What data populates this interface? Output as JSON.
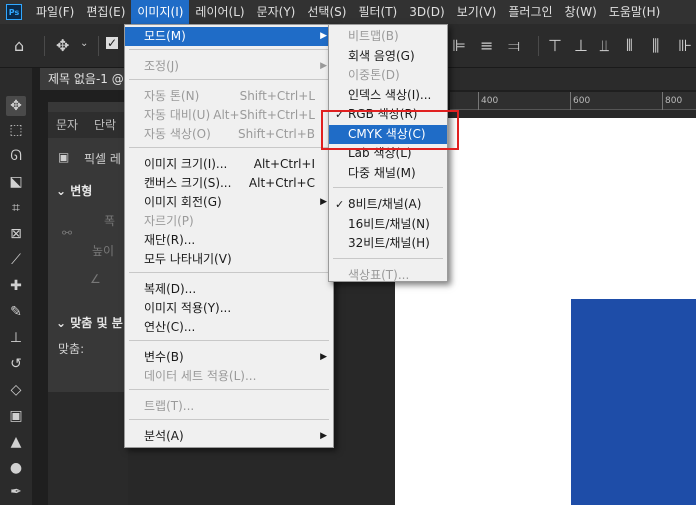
{
  "app": {
    "logo": "Ps"
  },
  "menubar": [
    "파일(F)",
    "편집(E)",
    "이미지(I)",
    "레이어(L)",
    "문자(Y)",
    "선택(S)",
    "필터(T)",
    "3D(D)",
    "보기(V)",
    "플러그인",
    "창(W)",
    "도움말(H)"
  ],
  "menubar_active_index": 2,
  "document_tab": {
    "title": "제목 없음-1 @"
  },
  "panel": {
    "tabs": [
      "문자",
      "단락"
    ],
    "pixel_label": "픽셀 레",
    "section_transform": "변형",
    "width_label": "폭",
    "height_label": "높이",
    "section_align": "맞춤 및 분",
    "align_label": "맞춤:"
  },
  "ruler": {
    "ticks": [
      "400",
      "600",
      "800"
    ]
  },
  "image_menu": {
    "items": [
      {
        "label": "모드(M)",
        "shortcut": "",
        "submenu": true,
        "disabled": false,
        "highlight": true
      },
      {
        "separator": true
      },
      {
        "label": "조정(J)",
        "shortcut": "",
        "submenu": true,
        "disabled": true
      },
      {
        "separator": true
      },
      {
        "label": "자동 톤(N)",
        "shortcut": "Shift+Ctrl+L",
        "disabled": true
      },
      {
        "label": "자동 대비(U)",
        "shortcut": "Alt+Shift+Ctrl+L",
        "disabled": true
      },
      {
        "label": "자동 색상(O)",
        "shortcut": "Shift+Ctrl+B",
        "disabled": true
      },
      {
        "separator": true
      },
      {
        "label": "이미지 크기(I)...",
        "shortcut": "Alt+Ctrl+I",
        "disabled": false
      },
      {
        "label": "캔버스 크기(S)...",
        "shortcut": "Alt+Ctrl+C",
        "disabled": false
      },
      {
        "label": "이미지 회전(G)",
        "shortcut": "",
        "submenu": true,
        "disabled": false
      },
      {
        "label": "자르기(P)",
        "shortcut": "",
        "disabled": true
      },
      {
        "label": "재단(R)...",
        "shortcut": "",
        "disabled": false
      },
      {
        "label": "모두 나타내기(V)",
        "shortcut": "",
        "disabled": false
      },
      {
        "separator": true
      },
      {
        "label": "복제(D)...",
        "shortcut": "",
        "disabled": false
      },
      {
        "label": "이미지 적용(Y)...",
        "shortcut": "",
        "disabled": false
      },
      {
        "label": "연산(C)...",
        "shortcut": "",
        "disabled": false
      },
      {
        "separator": true
      },
      {
        "label": "변수(B)",
        "shortcut": "",
        "submenu": true,
        "disabled": false
      },
      {
        "label": "데이터 세트 적용(L)...",
        "shortcut": "",
        "disabled": true
      },
      {
        "separator": true
      },
      {
        "label": "트랩(T)...",
        "shortcut": "",
        "disabled": true
      },
      {
        "separator": true
      },
      {
        "label": "분석(A)",
        "shortcut": "",
        "submenu": true,
        "disabled": false
      }
    ]
  },
  "mode_submenu": {
    "items": [
      {
        "label": "비트맵(B)",
        "disabled": true
      },
      {
        "label": "회색 음영(G)",
        "disabled": false
      },
      {
        "label": "이중톤(D)",
        "disabled": true
      },
      {
        "label": "인덱스 색상(I)...",
        "disabled": false
      },
      {
        "label": "RGB 색상(R)",
        "disabled": false,
        "checked": true
      },
      {
        "label": "CMYK 색상(C)",
        "disabled": false,
        "highlight": true
      },
      {
        "label": "Lab 색상(L)",
        "disabled": false
      },
      {
        "label": "다중 채널(M)",
        "disabled": false
      },
      {
        "separator": true
      },
      {
        "label": "8비트/채널(A)",
        "disabled": false,
        "checked": true
      },
      {
        "label": "16비트/채널(N)",
        "disabled": false
      },
      {
        "label": "32비트/채널(H)",
        "disabled": false
      },
      {
        "separator": true
      },
      {
        "label": "색상표(T)...",
        "disabled": true
      }
    ]
  },
  "colors": {
    "accent": "#1f6cc7",
    "annotation": "#e02020",
    "shape_fill": "#1e4da8"
  }
}
